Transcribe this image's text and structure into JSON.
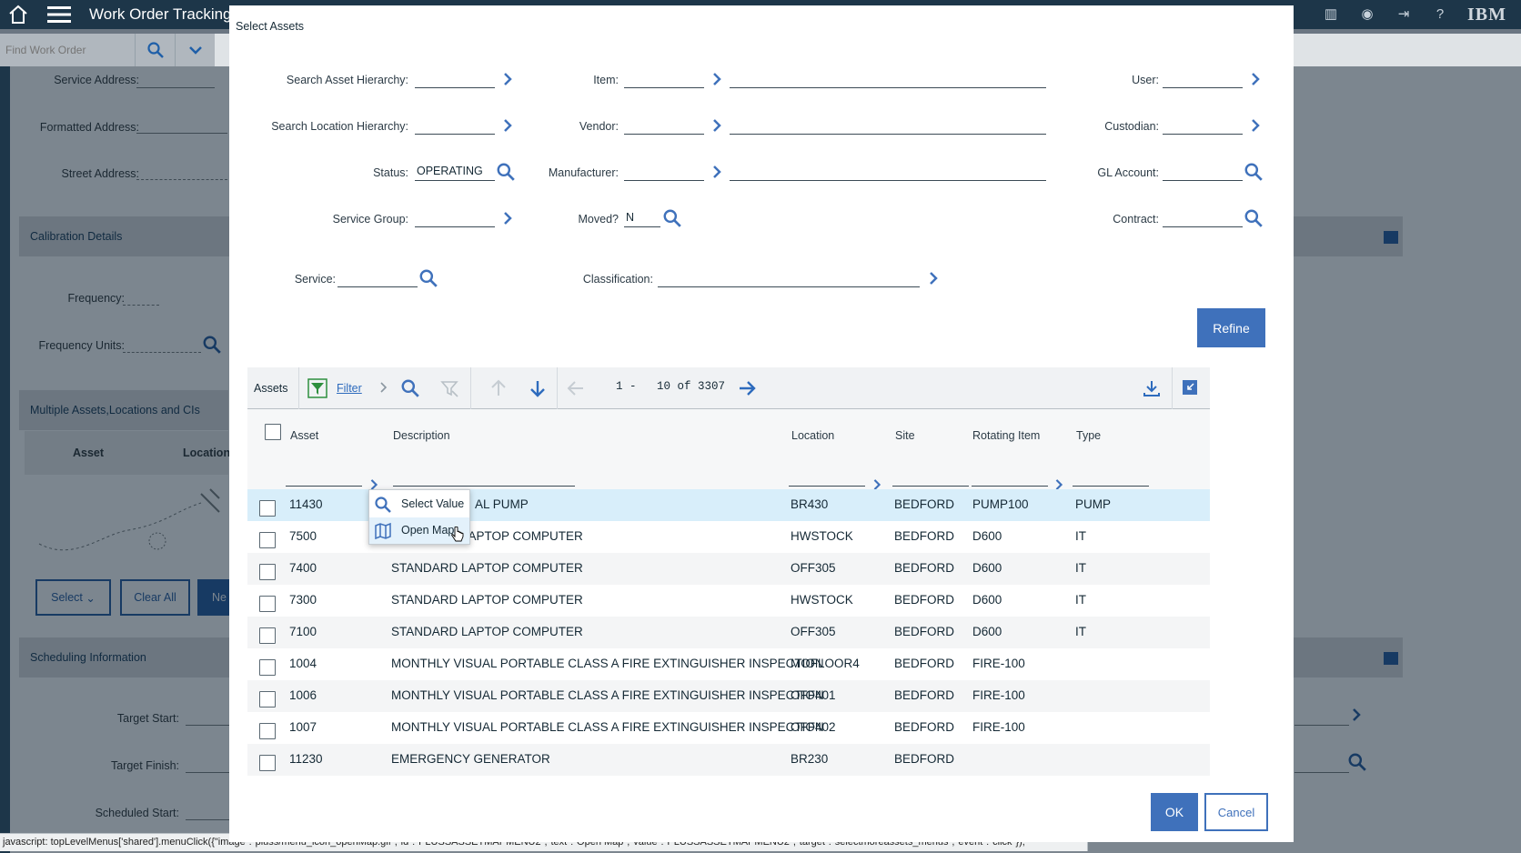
{
  "app": {
    "title": "Work Order Tracking",
    "brand": "IBM",
    "find_placeholder": "Find Work Order"
  },
  "background": {
    "fields": {
      "service_address": "Service Address:",
      "formatted_address": "Formatted Address:",
      "street_address": "Street Address:",
      "frequency": "Frequency:",
      "frequency_units": "Frequency Units:",
      "target_start": "Target Start:",
      "target_finish": "Target Finish:",
      "scheduled_start": "Scheduled Start:"
    },
    "sections": {
      "calibration": "Calibration Details",
      "multiple": "Multiple Assets,Locations and CIs",
      "scheduling": "Scheduling Information"
    },
    "multi_columns": {
      "asset": "Asset",
      "location": "Location"
    },
    "buttons": {
      "select": "Select",
      "clear_all": "Clear All",
      "new": "Ne"
    }
  },
  "dialog": {
    "title": "Select Assets",
    "fields": {
      "search_asset_hierarchy": {
        "label": "Search Asset Hierarchy:",
        "value": ""
      },
      "search_location_hierarchy": {
        "label": "Search Location Hierarchy:",
        "value": ""
      },
      "status": {
        "label": "Status:",
        "value": "OPERATING"
      },
      "service_group": {
        "label": "Service Group:",
        "value": ""
      },
      "service": {
        "label": "Service:",
        "value": ""
      },
      "item": {
        "label": "Item:",
        "value": ""
      },
      "vendor": {
        "label": "Vendor:",
        "value": ""
      },
      "manufacturer": {
        "label": "Manufacturer:",
        "value": ""
      },
      "moved": {
        "label": "Moved?",
        "value": "N"
      },
      "classification": {
        "label": "Classification:",
        "value": ""
      },
      "user": {
        "label": "User:",
        "value": ""
      },
      "custodian": {
        "label": "Custodian:",
        "value": ""
      },
      "gl_account": {
        "label": "GL Account:",
        "value": ""
      },
      "contract": {
        "label": "Contract:",
        "value": ""
      }
    },
    "refine_label": "Refine",
    "table": {
      "label": "Assets",
      "filter_label": "Filter",
      "page_start": "1 -",
      "page_range": "10 of 3307",
      "columns": {
        "asset": "Asset",
        "description": "Description",
        "location": "Location",
        "site": "Site",
        "rotating_item": "Rotating Item",
        "type": "Type"
      },
      "rows": [
        {
          "asset": "11430",
          "description": "AL PUMP",
          "location": "BR430",
          "site": "BEDFORD",
          "rotating_item": "PUMP100",
          "type": "PUMP"
        },
        {
          "asset": "7500",
          "description": "STANDARD LAPTOP COMPUTER",
          "location": "HWSTOCK",
          "site": "BEDFORD",
          "rotating_item": "D600",
          "type": "IT"
        },
        {
          "asset": "7400",
          "description": "STANDARD LAPTOP COMPUTER",
          "location": "OFF305",
          "site": "BEDFORD",
          "rotating_item": "D600",
          "type": "IT"
        },
        {
          "asset": "7300",
          "description": "STANDARD LAPTOP COMPUTER",
          "location": "HWSTOCK",
          "site": "BEDFORD",
          "rotating_item": "D600",
          "type": "IT"
        },
        {
          "asset": "7100",
          "description": "STANDARD LAPTOP COMPUTER",
          "location": "OFF305",
          "site": "BEDFORD",
          "rotating_item": "D600",
          "type": "IT"
        },
        {
          "asset": "1004",
          "description": "MONTHLY VISUAL PORTABLE CLASS A FIRE EXTINGUISHER INSPECTION",
          "location": "MOFLOOR4",
          "site": "BEDFORD",
          "rotating_item": "FIRE-100",
          "type": ""
        },
        {
          "asset": "1006",
          "description": "MONTHLY VISUAL PORTABLE CLASS A FIRE EXTINGUISHER INSPECTION",
          "location": "OFF401",
          "site": "BEDFORD",
          "rotating_item": "FIRE-100",
          "type": ""
        },
        {
          "asset": "1007",
          "description": "MONTHLY VISUAL PORTABLE CLASS A FIRE EXTINGUISHER INSPECTION",
          "location": "OFF402",
          "site": "BEDFORD",
          "rotating_item": "FIRE-100",
          "type": ""
        },
        {
          "asset": "11230",
          "description": "EMERGENCY GENERATOR",
          "location": "BR230",
          "site": "BEDFORD",
          "rotating_item": "",
          "type": ""
        }
      ]
    },
    "context_menu": {
      "select_value": "Select Value",
      "open_map": "Open Map"
    },
    "ok_label": "OK",
    "cancel_label": "Cancel"
  },
  "status_bar": "javascript: topLevelMenus['shared'].menuClick({\"image\":\"pluss/menu_icon_openMap.gif\",\"id\":\"PLUSSASSETMAPMENU2\",\"text\":\"Open Map\",\"value\":\"PLUSSASSETMAPMENU2\",\"target\":\"selectmoreassets_menus\",\"event\":\"click\"});",
  "colors": {
    "accent": "#3f71bb",
    "topbar": "#1d3649",
    "selected_row": "#d8eefa",
    "overlay": "#7c868f"
  },
  "icons": [
    "home-icon",
    "hamburger-menu-icon",
    "search-icon",
    "chevron-right-icon",
    "chevron-down-icon",
    "filter-icon",
    "clear-filter-icon",
    "arrow-up-icon",
    "arrow-down-icon",
    "arrow-left-icon",
    "arrow-right-icon",
    "download-icon",
    "collapse-icon",
    "map-icon",
    "cursor-icon",
    "chart-icon",
    "user-icon",
    "logout-icon",
    "help-icon"
  ]
}
